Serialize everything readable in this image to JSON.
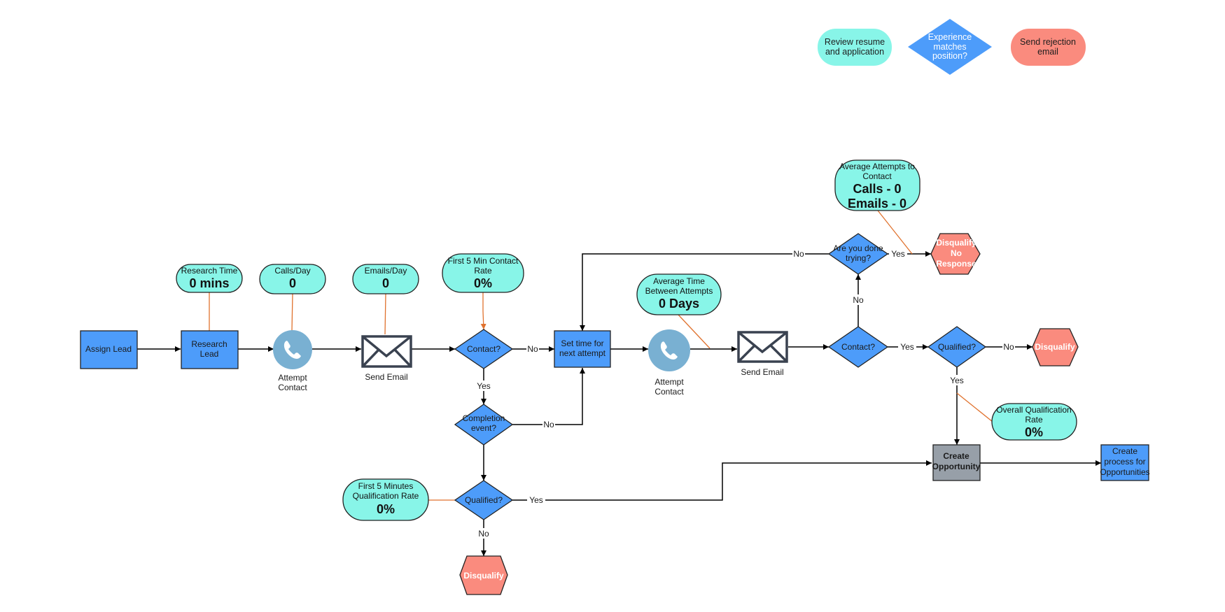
{
  "colors": {
    "process_blue": "#4d9cfa",
    "metric_teal": "#88f5e8",
    "disqualify_salmon": "#fa8b7e",
    "opportunity_gray": "#979fa8",
    "phone_circle": "#79b0d2",
    "envelope_stroke": "#3a4250",
    "connector": "#000000",
    "annotation_line": "#e0722e"
  },
  "legend": [
    {
      "shape": "terminal",
      "label_lines": [
        "Review resume",
        "and application"
      ]
    },
    {
      "shape": "decision",
      "label_lines": [
        "Experience",
        "matches",
        "position?"
      ]
    },
    {
      "shape": "terminal",
      "label_lines": [
        "Send rejection",
        "email"
      ]
    }
  ],
  "nodes": {
    "assign_lead": {
      "lines": [
        "Assign Lead"
      ]
    },
    "research_lead": {
      "lines": [
        "Research",
        "Lead"
      ]
    },
    "attempt_contact_1": {
      "icon": "phone-icon",
      "lines": [
        "Attempt",
        "Contact"
      ]
    },
    "send_email_1": {
      "icon": "envelope-icon",
      "lines": [
        "Send Email"
      ]
    },
    "contact_1": {
      "lines": [
        "Contact?"
      ]
    },
    "completion_event": {
      "lines": [
        "Completion",
        "event?"
      ]
    },
    "qualified_1": {
      "lines": [
        "Qualified?"
      ]
    },
    "disqualify_1": {
      "lines": [
        "Disqualify"
      ]
    },
    "set_time": {
      "lines": [
        "Set time for",
        "next attempt"
      ]
    },
    "attempt_contact_2": {
      "icon": "phone-icon",
      "lines": [
        "Attempt",
        "Contact"
      ]
    },
    "send_email_2": {
      "icon": "envelope-icon",
      "lines": [
        "Send Email"
      ]
    },
    "contact_2": {
      "lines": [
        "Contact?"
      ]
    },
    "done_trying": {
      "lines": [
        "Are you done",
        "trying?"
      ]
    },
    "disqualify_no_response": {
      "lines": [
        "Disqualify",
        "No",
        "Response"
      ]
    },
    "qualified_2": {
      "lines": [
        "Qualified?"
      ]
    },
    "disqualify_2": {
      "lines": [
        "Disqualify"
      ]
    },
    "create_opportunity": {
      "lines": [
        "Create",
        "Opportunity"
      ]
    },
    "create_process": {
      "lines": [
        "Create",
        "process for",
        "Opportunities"
      ]
    }
  },
  "metrics": {
    "research_time": {
      "title_lines": [
        "Research Time"
      ],
      "value_lines": [
        "0 mins"
      ]
    },
    "calls_day": {
      "title_lines": [
        "Calls/Day"
      ],
      "value_lines": [
        "0"
      ]
    },
    "emails_day": {
      "title_lines": [
        "Emails/Day"
      ],
      "value_lines": [
        "0"
      ]
    },
    "first5_contact": {
      "title_lines": [
        "First 5 Min Contact",
        "Rate"
      ],
      "value_lines": [
        "0%"
      ]
    },
    "avg_time_between": {
      "title_lines": [
        "Average Time",
        "Between Attempts"
      ],
      "value_lines": [
        "0 Days"
      ]
    },
    "avg_attempts": {
      "title_lines": [
        "Average Attempts to",
        "Contact"
      ],
      "value_lines": [
        "Calls - 0",
        "Emails - 0"
      ]
    },
    "first5_qualification": {
      "title_lines": [
        "First 5 Minutes",
        "Qualification Rate"
      ],
      "value_lines": [
        "0%"
      ]
    },
    "overall_qualification": {
      "title_lines": [
        "Overall Qualification",
        "Rate"
      ],
      "value_lines": [
        "0%"
      ]
    }
  },
  "edge_labels": {
    "contact1_no": "No",
    "contact1_yes": "Yes",
    "completion_no": "No",
    "qualified1_yes": "Yes",
    "qualified1_no": "No",
    "contact2_yes": "Yes",
    "contact2_no": "No",
    "done_no": "No",
    "done_yes": "Yes",
    "qualified2_no": "No",
    "qualified2_yes": "Yes"
  }
}
